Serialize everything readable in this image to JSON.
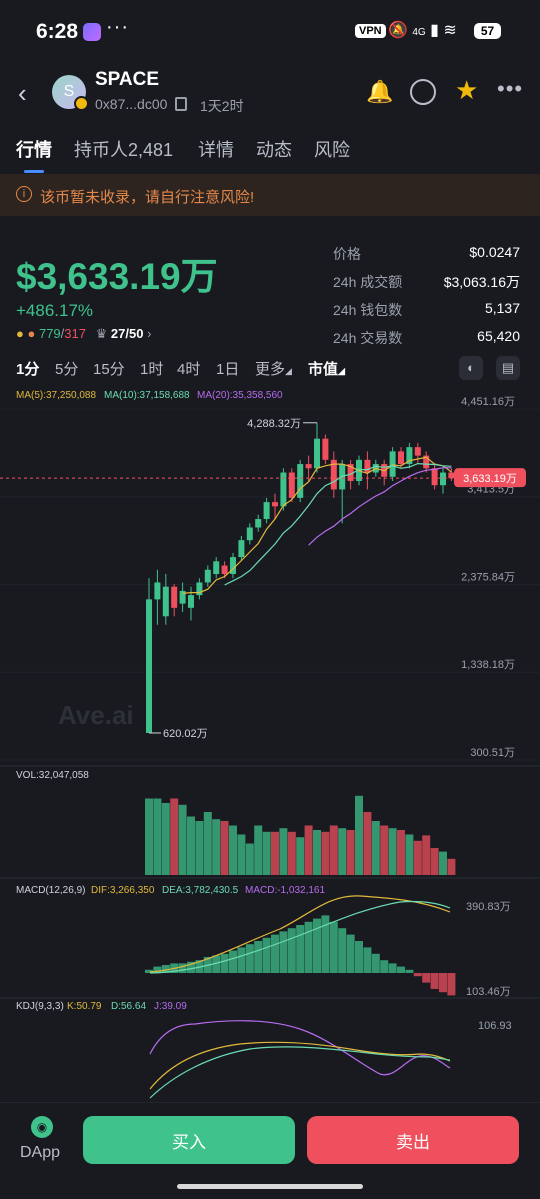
{
  "status_bar": {
    "time": "6:28",
    "dots": "···",
    "vpn": "VPN",
    "network": "4G",
    "battery": "57"
  },
  "header": {
    "back_icon": "chevron-left-icon",
    "avatar_letter": "S",
    "token_name": "SPACE",
    "address": "0x87...dc00",
    "age": "1天2时"
  },
  "tabs": [
    {
      "label": "行情",
      "active": true
    },
    {
      "label": "持币人2,481",
      "active": false
    },
    {
      "label": "详情",
      "active": false
    },
    {
      "label": "动态",
      "active": false
    },
    {
      "label": "风险",
      "active": false
    }
  ],
  "warning": {
    "icon": "i",
    "text": "该币暂未收录，请自行注意风险!"
  },
  "summary": {
    "market_cap": "$3,633.19万",
    "change": "+486.17%",
    "buys": "779",
    "sells": "317",
    "holders_ratio": "27/50"
  },
  "stats": [
    {
      "label": "价格",
      "value": "$0.0247"
    },
    {
      "label": "24h 成交额",
      "value": "$3,063.16万"
    },
    {
      "label": "24h 钱包数",
      "value": "5,137"
    },
    {
      "label": "24h 交易数",
      "value": "65,420"
    }
  ],
  "intervals": [
    "1分",
    "5分",
    "15分",
    "1时",
    "4时",
    "1日",
    "更多",
    "市值"
  ],
  "active_interval": "1分",
  "colors": {
    "up": "#3fc28b",
    "down": "#f0505e",
    "ma5": "#e2b93b",
    "ma10": "#6bdcb0",
    "ma20": "#b86bf0",
    "accent": "#4a8cff"
  },
  "chart_data": {
    "type": "candlestick",
    "ma_legend": {
      "ma5": "MA(5):37,250,088",
      "ma10": "MA(10):37,158,688",
      "ma20": "MA(20):35,358,560"
    },
    "y_ticks": [
      "4,451.16万",
      "3,413.5万",
      "2,375.84万",
      "1,338.18万",
      "300.51万"
    ],
    "y_tick_values": [
      4451.16,
      3413.5,
      2375.84,
      1338.18,
      300.51
    ],
    "current_label": "3,633.19万",
    "current_value": 3633.19,
    "high_label": "4,288.32万",
    "high_value": 4288.32,
    "low_label": "620.02万",
    "low_value": 620.02,
    "watermark": "Ave.ai",
    "candles": [
      [
        620,
        2200,
        620,
        2450
      ],
      [
        2200,
        2400,
        1900,
        2550
      ],
      [
        2000,
        2350,
        1900,
        2500
      ],
      [
        2350,
        2100,
        2000,
        2380
      ],
      [
        2150,
        2300,
        2050,
        2400
      ],
      [
        2100,
        2250,
        1950,
        2350
      ],
      [
        2250,
        2400,
        2200,
        2450
      ],
      [
        2400,
        2550,
        2350,
        2600
      ],
      [
        2500,
        2650,
        2450,
        2700
      ],
      [
        2600,
        2500,
        2450,
        2650
      ],
      [
        2500,
        2700,
        2450,
        2750
      ],
      [
        2700,
        2900,
        2650,
        2950
      ],
      [
        2900,
        3050,
        2850,
        3100
      ],
      [
        3050,
        3150,
        3000,
        3200
      ],
      [
        3150,
        3350,
        3100,
        3400
      ],
      [
        3350,
        3300,
        3150,
        3450
      ],
      [
        3300,
        3700,
        3250,
        3750
      ],
      [
        3700,
        3400,
        3350,
        3750
      ],
      [
        3400,
        3800,
        3350,
        3850
      ],
      [
        3800,
        3750,
        3600,
        3900
      ],
      [
        3750,
        4100,
        3700,
        4288
      ],
      [
        4100,
        3850,
        3800,
        4150
      ],
      [
        3850,
        3500,
        3400,
        3950
      ],
      [
        3500,
        3800,
        3100,
        3850
      ],
      [
        3800,
        3600,
        3500,
        3850
      ],
      [
        3600,
        3850,
        3550,
        3900
      ],
      [
        3850,
        3700,
        3500,
        3950
      ],
      [
        3700,
        3800,
        3650,
        3850
      ],
      [
        3800,
        3650,
        3550,
        3850
      ],
      [
        3650,
        3950,
        3600,
        4000
      ],
      [
        3950,
        3800,
        3750,
        4000
      ],
      [
        3800,
        4000,
        3750,
        4050
      ],
      [
        4000,
        3900,
        3800,
        4050
      ],
      [
        3900,
        3750,
        3700,
        3950
      ],
      [
        3750,
        3550,
        3500,
        3800
      ],
      [
        3550,
        3700,
        3450,
        3750
      ],
      [
        3700,
        3633,
        3600,
        3750
      ]
    ],
    "volume_label": "VOL:32,047,058",
    "volume": [
      85,
      85,
      80,
      85,
      78,
      65,
      60,
      70,
      62,
      60,
      55,
      45,
      35,
      55,
      48,
      48,
      52,
      48,
      42,
      55,
      50,
      48,
      55,
      52,
      50,
      88,
      70,
      60,
      55,
      52,
      50,
      45,
      38,
      44,
      30,
      26,
      18
    ],
    "macd_label": "MACD(12,26,9)",
    "macd_dif": "DIF:3,266,350",
    "macd_dea": "DEA:3,782,430.5",
    "macd_macd": "MACD:-1,032,161",
    "macd_ticks": [
      "390.83万",
      "103.46万"
    ],
    "macd_hist": [
      2,
      4,
      5,
      6,
      6,
      7,
      8,
      10,
      11,
      12,
      14,
      16,
      18,
      20,
      22,
      24,
      26,
      28,
      30,
      32,
      34,
      36,
      32,
      28,
      24,
      20,
      16,
      12,
      8,
      6,
      4,
      2,
      -2,
      -6,
      -10,
      -12,
      -14
    ],
    "kdj_label": "KDJ(9,3,3)",
    "kdj_k": "K:50.79",
    "kdj_d": "D:56.64",
    "kdj_j": "J:39.09",
    "kdj_tick": "106.93"
  },
  "bottom": {
    "dapp_label": "DApp",
    "buy_label": "买入",
    "sell_label": "卖出"
  }
}
